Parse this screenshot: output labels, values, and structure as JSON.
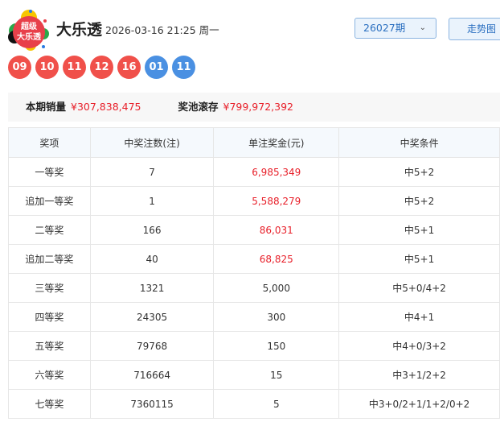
{
  "header": {
    "logo_text": "超级大乐透",
    "title": "大乐透",
    "datetime": "2026-03-16 21:25 周一",
    "issue": "26027期",
    "trend_button": "走势图"
  },
  "balls": {
    "front": [
      "09",
      "10",
      "11",
      "12",
      "16"
    ],
    "back": [
      "01",
      "11"
    ],
    "colors": {
      "front": "#f0504a",
      "back": "#4a90e2"
    }
  },
  "summary": {
    "sales_label": "本期销量",
    "sales": "¥307,838,475",
    "pool_label": "奖池滚存",
    "pool": "¥799,972,392"
  },
  "table": {
    "headers": [
      "奖项",
      "中奖注数(注)",
      "单注奖金(元)",
      "中奖条件"
    ],
    "rows": [
      {
        "prize": "一等奖",
        "count": "7",
        "amount": "6,985,349",
        "cond": "中5+2",
        "highlight": true
      },
      {
        "prize": "追加一等奖",
        "count": "1",
        "amount": "5,588,279",
        "cond": "中5+2",
        "highlight": true
      },
      {
        "prize": "二等奖",
        "count": "166",
        "amount": "86,031",
        "cond": "中5+1",
        "highlight": true
      },
      {
        "prize": "追加二等奖",
        "count": "40",
        "amount": "68,825",
        "cond": "中5+1",
        "highlight": true
      },
      {
        "prize": "三等奖",
        "count": "1321",
        "amount": "5,000",
        "cond": "中5+0/4+2",
        "highlight": false
      },
      {
        "prize": "四等奖",
        "count": "24305",
        "amount": "300",
        "cond": "中4+1",
        "highlight": false
      },
      {
        "prize": "五等奖",
        "count": "79768",
        "amount": "150",
        "cond": "中4+0/3+2",
        "highlight": false
      },
      {
        "prize": "六等奖",
        "count": "716664",
        "amount": "15",
        "cond": "中3+1/2+2",
        "highlight": false
      },
      {
        "prize": "七等奖",
        "count": "7360115",
        "amount": "5",
        "cond": "中3+0/2+1/1+2/0+2",
        "highlight": false
      }
    ]
  }
}
